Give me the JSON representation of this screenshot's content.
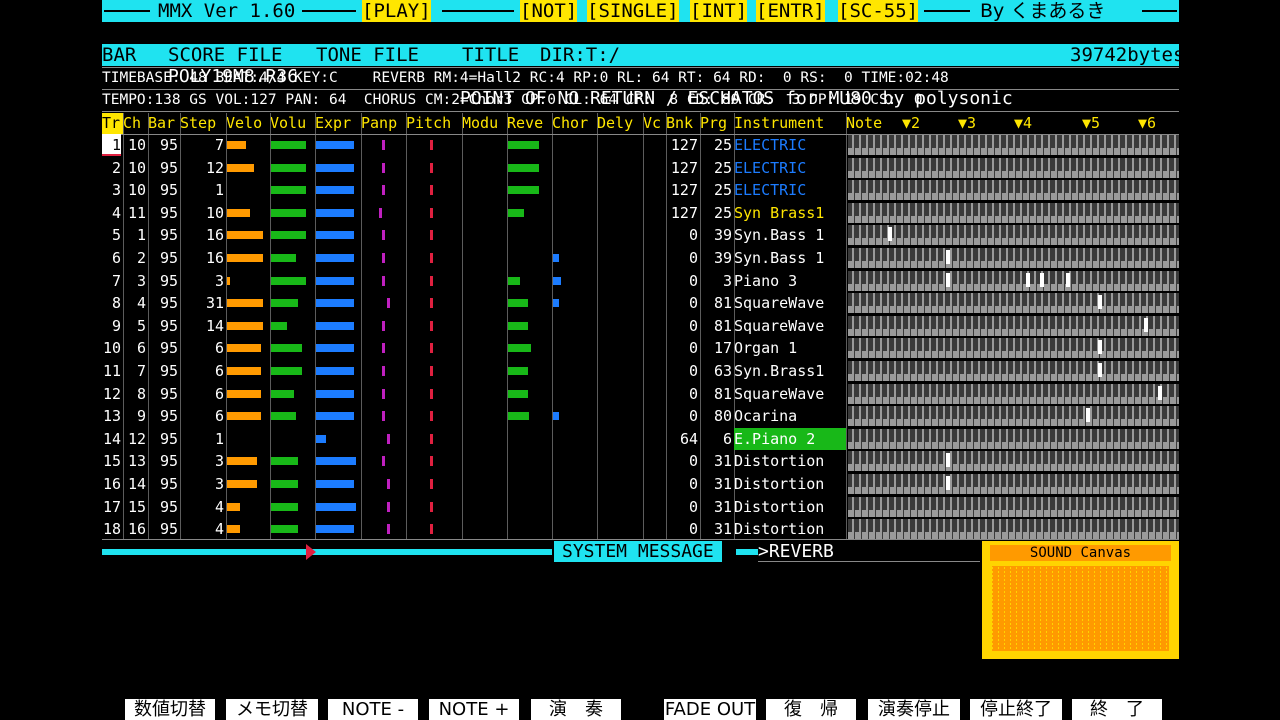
{
  "titlebar": {
    "app": "MMX Ver 1.60",
    "play": "[PLAY]",
    "not": "[NOT]",
    "single": "[SINGLE]",
    "int": "[INT]",
    "entr": "[ENTR]",
    "sc55": "[SC-55]",
    "author": "By くまあるき"
  },
  "fileline": {
    "counter": "0000",
    "filename": "POLY19M8.R36",
    "song_title": "POINT OF NO RETURN / ESCHATOS for MU80 by polysonic"
  },
  "menu": {
    "bar": "BAR",
    "score_file": "SCORE FILE",
    "tone_file": "TONE FILE",
    "title": "TITLE",
    "dir": "DIR:T:/",
    "bytes": "39742bytes"
  },
  "info1": "TIMEBASE: 48 BEAT:4/4 KEY:C    REVERB RM:4=Hall2 RC:4 RP:0 RL: 64 RT: 64 RD:  0 RS:  0 TIME:02:48",
  "info2": "TEMPO:138 GS VOL:127 PAN: 64  CHORUS CM:2=Chor3 CP:0 CL: 64 CF:  8 CD: 80 CR:  3 DP: 19 CS:  0",
  "columns": [
    "Tr",
    "Ch",
    "Bar",
    "Step",
    "Velo",
    "Volu",
    "Expr",
    "Panp",
    "Pitch",
    "Modu",
    "Reve",
    "Chor",
    "Dely",
    "Vc",
    "Bnk",
    "Prg",
    "Instrument",
    "Note"
  ],
  "note_markers": [
    "▼2",
    "▼3",
    "▼4",
    "▼5",
    "▼6"
  ],
  "tracks": [
    {
      "tr": "1",
      "ch": "10",
      "bar": "95",
      "step": "7",
      "velo": 0.5,
      "volu": 0.9,
      "expr": 0.95,
      "pan": 64,
      "pitch": 64,
      "reve": 0.8,
      "chor": 0,
      "bnk": "127",
      "prg": "25",
      "inst": "ELECTRIC",
      "inst_color": "#1c7cff"
    },
    {
      "tr": "2",
      "ch": "10",
      "bar": "95",
      "step": "12",
      "velo": 0.7,
      "volu": 0.9,
      "expr": 0.95,
      "pan": 64,
      "pitch": 64,
      "reve": 0.8,
      "chor": 0,
      "bnk": "127",
      "prg": "25",
      "inst": "ELECTRIC",
      "inst_color": "#1c7cff"
    },
    {
      "tr": "3",
      "ch": "10",
      "bar": "95",
      "step": "1",
      "velo": 0,
      "volu": 0.9,
      "expr": 0.95,
      "pan": 64,
      "pitch": 64,
      "reve": 0.8,
      "chor": 0,
      "bnk": "127",
      "prg": "25",
      "inst": "ELECTRIC",
      "inst_color": "#1c7cff"
    },
    {
      "tr": "4",
      "ch": "11",
      "bar": "95",
      "step": "10",
      "velo": 0.6,
      "volu": 0.9,
      "expr": 0.95,
      "pan": 56,
      "pitch": 64,
      "reve": 0.4,
      "chor": 0,
      "bnk": "127",
      "prg": "25",
      "inst": "Syn Brass1",
      "inst_color": "#ffe600"
    },
    {
      "tr": "5",
      "ch": "1",
      "bar": "95",
      "step": "16",
      "velo": 0.95,
      "volu": 0.9,
      "expr": 0.95,
      "pan": 64,
      "pitch": 64,
      "reve": 0,
      "chor": 0,
      "bnk": "0",
      "prg": "39",
      "inst": "Syn.Bass 1",
      "inst_color": "#ffffff"
    },
    {
      "tr": "6",
      "ch": "2",
      "bar": "95",
      "step": "16",
      "velo": 0.95,
      "volu": 0.65,
      "expr": 0.95,
      "pan": 64,
      "pitch": 64,
      "reve": 0,
      "chor": 0.15,
      "bnk": "0",
      "prg": "39",
      "inst": "Syn.Bass 1",
      "inst_color": "#ffffff"
    },
    {
      "tr": "7",
      "ch": "3",
      "bar": "95",
      "step": "3",
      "velo": 0.08,
      "volu": 0.9,
      "expr": 0.95,
      "pan": 64,
      "pitch": 64,
      "reve": 0.3,
      "chor": 0.2,
      "bnk": "0",
      "prg": "3",
      "inst": "Piano 3",
      "inst_color": "#ffffff"
    },
    {
      "tr": "8",
      "ch": "4",
      "bar": "95",
      "step": "31",
      "velo": 0.95,
      "volu": 0.7,
      "expr": 0.95,
      "pan": 80,
      "pitch": 64,
      "reve": 0.5,
      "chor": 0.15,
      "bnk": "0",
      "prg": "81",
      "inst": "SquareWave",
      "inst_color": "#ffffff"
    },
    {
      "tr": "9",
      "ch": "5",
      "bar": "95",
      "step": "14",
      "velo": 0.95,
      "volu": 0.4,
      "expr": 0.95,
      "pan": 64,
      "pitch": 64,
      "reve": 0.5,
      "chor": 0,
      "bnk": "0",
      "prg": "81",
      "inst": "SquareWave",
      "inst_color": "#ffffff"
    },
    {
      "tr": "10",
      "ch": "6",
      "bar": "95",
      "step": "6",
      "velo": 0.9,
      "volu": 0.8,
      "expr": 0.95,
      "pan": 64,
      "pitch": 64,
      "reve": 0.6,
      "chor": 0,
      "bnk": "0",
      "prg": "17",
      "inst": "Organ 1",
      "inst_color": "#ffffff"
    },
    {
      "tr": "11",
      "ch": "7",
      "bar": "95",
      "step": "6",
      "velo": 0.9,
      "volu": 0.8,
      "expr": 0.95,
      "pan": 64,
      "pitch": 64,
      "reve": 0.5,
      "chor": 0,
      "bnk": "0",
      "prg": "63",
      "inst": "Syn.Brass1",
      "inst_color": "#ffffff"
    },
    {
      "tr": "12",
      "ch": "8",
      "bar": "95",
      "step": "6",
      "velo": 0.9,
      "volu": 0.6,
      "expr": 0.95,
      "pan": 64,
      "pitch": 64,
      "reve": 0.5,
      "chor": 0,
      "bnk": "0",
      "prg": "81",
      "inst": "SquareWave",
      "inst_color": "#ffffff"
    },
    {
      "tr": "13",
      "ch": "9",
      "bar": "95",
      "step": "6",
      "velo": 0.9,
      "volu": 0.65,
      "expr": 0.95,
      "pan": 64,
      "pitch": 64,
      "reve": 0.55,
      "chor": 0.15,
      "bnk": "0",
      "prg": "80",
      "inst": "Ocarina",
      "inst_color": "#ffffff"
    },
    {
      "tr": "14",
      "ch": "12",
      "bar": "95",
      "step": "1",
      "velo": 0,
      "volu": 0,
      "expr": 0.25,
      "pan": 80,
      "pitch": 64,
      "reve": 0,
      "chor": 0,
      "bnk": "64",
      "prg": "6",
      "inst": "E.Piano 2",
      "inst_color": "#ffffff",
      "inst_bg": "#18b818"
    },
    {
      "tr": "15",
      "ch": "13",
      "bar": "95",
      "step": "3",
      "velo": 0.8,
      "volu": 0.7,
      "expr": 1.0,
      "pan": 64,
      "pitch": 64,
      "reve": 0,
      "chor": 0,
      "bnk": "0",
      "prg": "31",
      "inst": "Distortion",
      "inst_color": "#ffffff"
    },
    {
      "tr": "16",
      "ch": "14",
      "bar": "95",
      "step": "3",
      "velo": 0.8,
      "volu": 0.7,
      "expr": 0.95,
      "pan": 80,
      "pitch": 64,
      "reve": 0,
      "chor": 0,
      "bnk": "0",
      "prg": "31",
      "inst": "Distortion",
      "inst_color": "#ffffff"
    },
    {
      "tr": "17",
      "ch": "15",
      "bar": "95",
      "step": "4",
      "velo": 0.35,
      "volu": 0.7,
      "expr": 1.0,
      "pan": 80,
      "pitch": 64,
      "reve": 0,
      "chor": 0,
      "bnk": "0",
      "prg": "31",
      "inst": "Distortion",
      "inst_color": "#ffffff"
    },
    {
      "tr": "18",
      "ch": "16",
      "bar": "95",
      "step": "4",
      "velo": 0.35,
      "volu": 0.7,
      "expr": 0.95,
      "pan": 80,
      "pitch": 64,
      "reve": 0,
      "chor": 0,
      "bnk": "0",
      "prg": "31",
      "inst": "Distortion",
      "inst_color": "#ffffff"
    }
  ],
  "system": {
    "label": "SYSTEM MESSAGE",
    "message": ">REVERB",
    "sound_canvas": "SOUND Canvas"
  },
  "fkeys": [
    "数値切替",
    "メモ切替",
    "NOTE -",
    "NOTE +",
    "演　奏",
    "FADE OUT",
    "復　帰",
    "演奏停止",
    "停止終了",
    "終　了"
  ],
  "colors": {
    "cyan": "#1fe3f0",
    "yellow": "#ffe600",
    "orange": "#ff9a00",
    "green": "#18b818",
    "blue": "#1c7cff",
    "magenta": "#c020c0",
    "red": "#e02040"
  }
}
